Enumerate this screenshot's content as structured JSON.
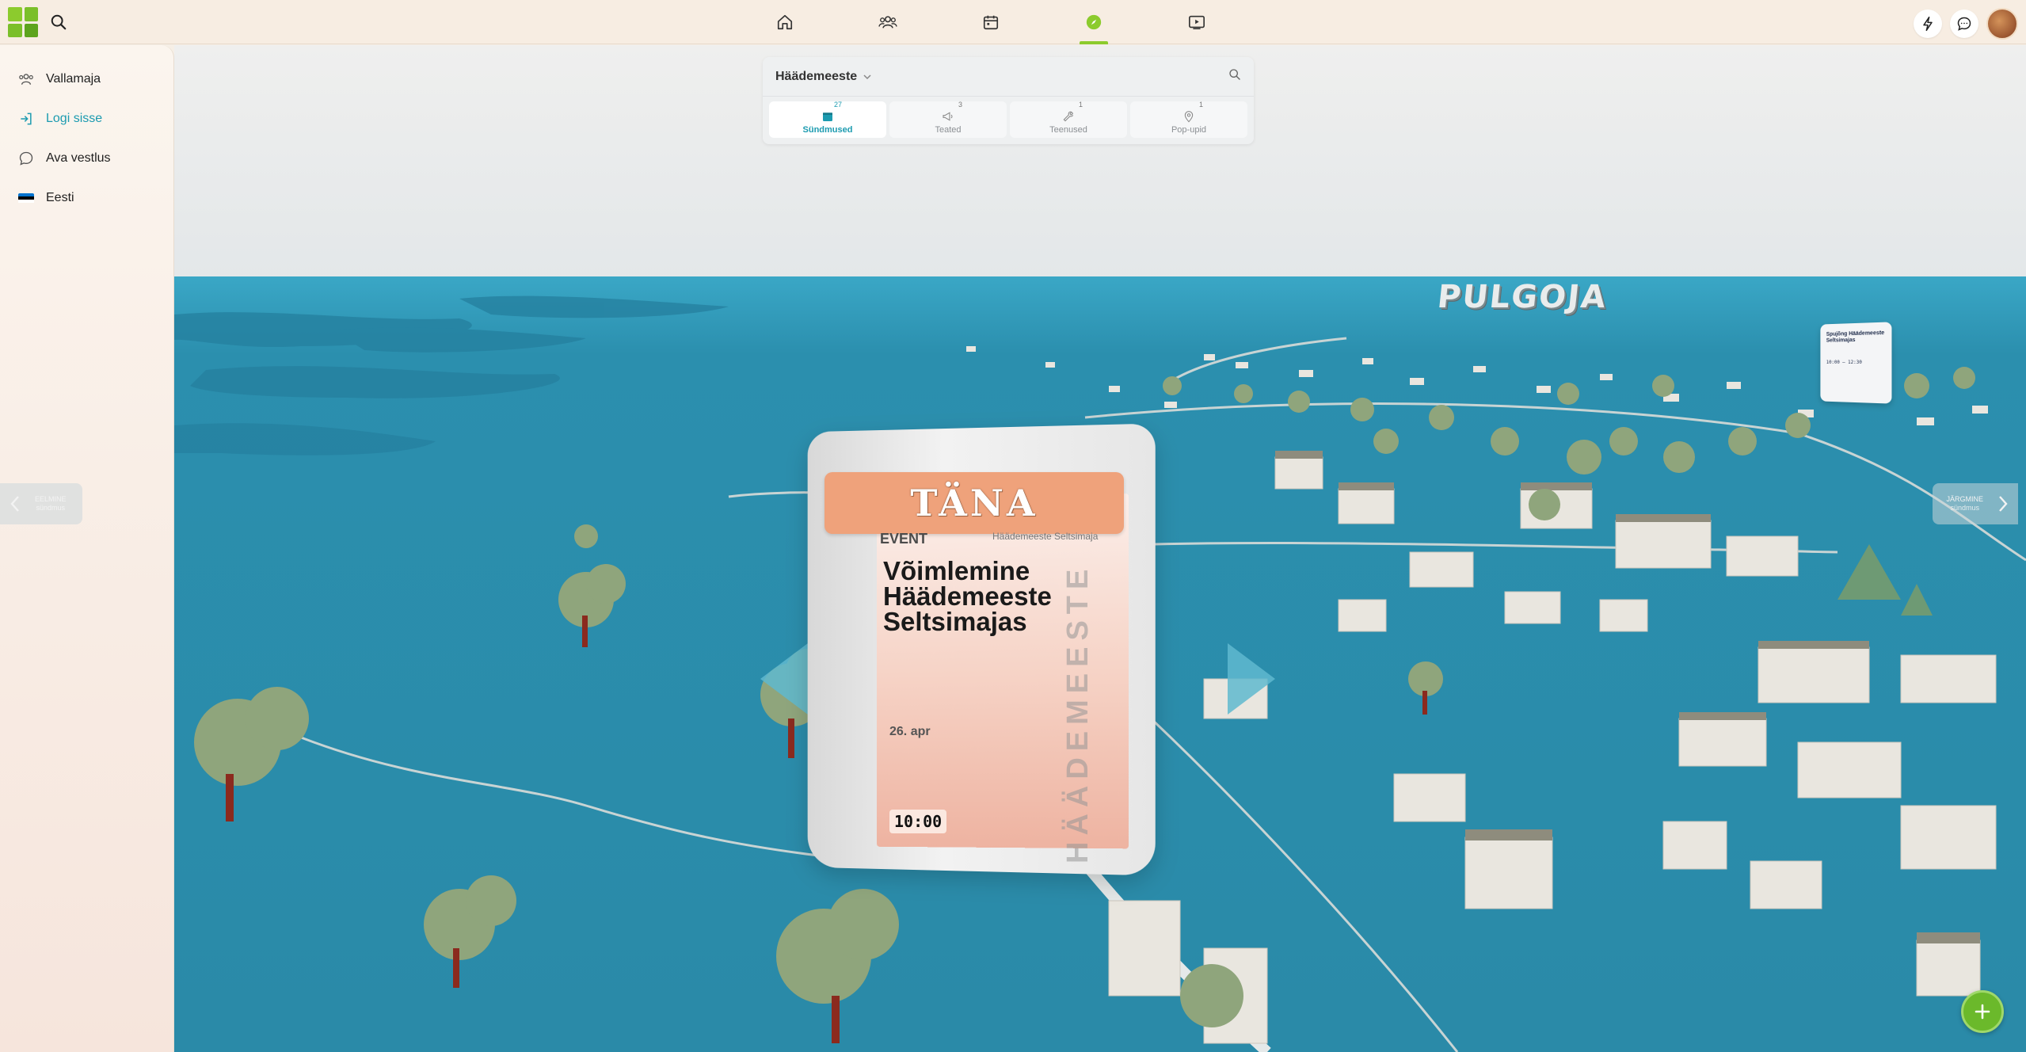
{
  "sidebar": {
    "items": [
      {
        "label": "Vallamaja",
        "icon": "community-icon"
      },
      {
        "label": "Logi sisse",
        "icon": "login-icon"
      },
      {
        "label": "Ava vestlus",
        "icon": "chat-bubble-icon"
      },
      {
        "label": "Eesti",
        "icon": "estonia-flag-icon"
      }
    ]
  },
  "search": {
    "location": "Häädemeeste",
    "tabs": [
      {
        "label": "Sündmused",
        "count": "27",
        "active": true
      },
      {
        "label": "Teated",
        "count": "3",
        "active": false
      },
      {
        "label": "Teenused",
        "count": "1",
        "active": false
      },
      {
        "label": "Pop-upid",
        "count": "1",
        "active": false
      }
    ]
  },
  "navigation": {
    "prev_line1": "EELMINE",
    "prev_line2": "sündmus",
    "next_line1": "JÄRGMINE",
    "next_line2": "sündmus"
  },
  "event_card": {
    "banner": "TÄNA",
    "type": "EVENT",
    "organizer": "Häädemeeste Seltsimaja",
    "title": "Võimlemine Häädemeeste Seltsimajas",
    "vertical_text": "HÄÄDEMEESTE",
    "date": "26. apr",
    "time": "10:00"
  },
  "map": {
    "place_label": "PULGOJA"
  },
  "mini_card": {
    "title": "Spujõng Häädemeeste Seltsimajas",
    "time": "10:00 — 12:30"
  },
  "colors": {
    "accent": "#8ccb2d",
    "link": "#1c9bb0",
    "water": "#2a8fae",
    "banner": "#efa27b"
  }
}
